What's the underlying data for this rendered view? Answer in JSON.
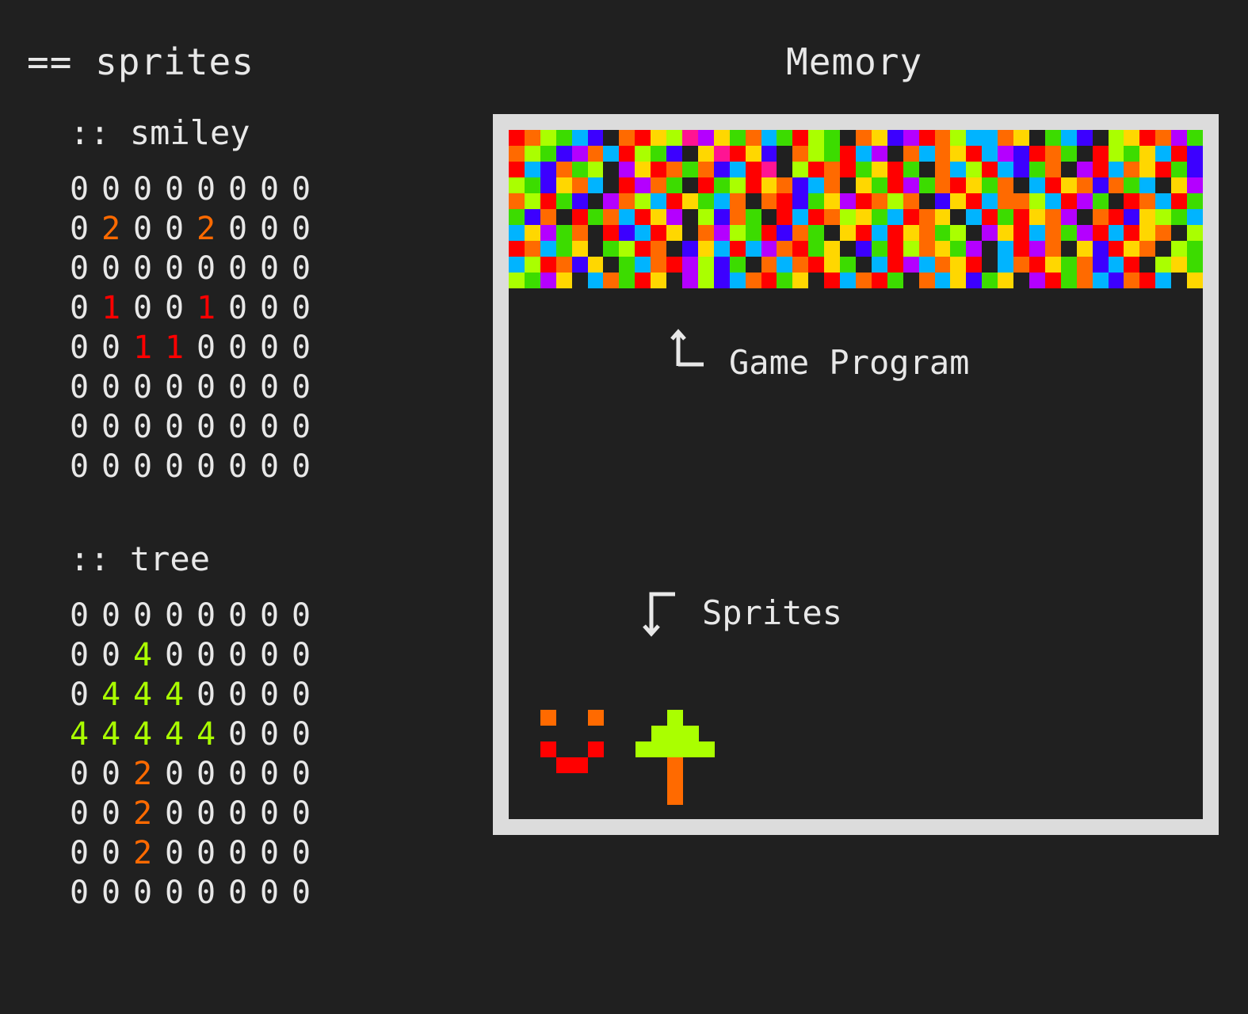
{
  "left_panel": {
    "title": "== sprites",
    "sprites": [
      {
        "name": ":: smiley",
        "rows": [
          "00000000",
          "02002000",
          "00000000",
          "01001000",
          "00110000",
          "00000000",
          "00000000",
          "00000000"
        ]
      },
      {
        "name": ":: tree",
        "rows": [
          "00000000",
          "00400000",
          "04440000",
          "44444000",
          "00200000",
          "00200000",
          "00200000",
          "00000000"
        ]
      }
    ]
  },
  "memory": {
    "title": "Memory",
    "program_label": "Game Program",
    "sprites_label": "Sprites",
    "program_columns": 44,
    "program_rows": 10,
    "program_cells": [
      "1245670213498352651450237812466230567043128561",
      "2457826145703913702451680262316871250145361724",
      "1672540831252761904121531502641675208162315724",
      "4573260182501541327620351852135206132725603812",
      "2415708246135620217538124207316224618501261534",
      "5720152613804725016124356123061513280217345614",
      "6385201761302845172503161325408316258161320487",
      "1265305412073616821530751423580618203713204512",
      "6412730562184750262135061862310621352761043568",
      "4583062513084762153016215026375308152672160345"
    ]
  },
  "palette": {
    "0": "#202020",
    "1": "#ff0000",
    "2": "#ff6a00",
    "3": "#ffd700",
    "4": "#aaff00",
    "5": "#3cdc00",
    "6": "#00b4ff",
    "7": "#3c00ff",
    "8": "#b400ff",
    "9": "#ff1493",
    "text": "#e8e8e8",
    "frame": "#dcdcdc",
    "background": "#202020"
  }
}
